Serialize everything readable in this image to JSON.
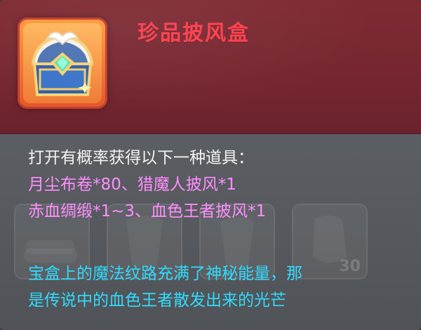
{
  "item": {
    "name": "珍品披风盒",
    "name_color": "#ff3c4a",
    "icon": "treasure-chest-icon"
  },
  "description": {
    "intro": "打开有概率获得以下一种道具：",
    "rewards": [
      "月尘布卷*80、猎魔人披风*1",
      "赤血绸缎*1~3、血色王者披风*1"
    ],
    "flavor": [
      "宝盒上的魔法纹路充满了神秘能量，那",
      "是传说中的血色王者散发出来的光芒"
    ]
  },
  "background_slots": [
    {
      "icon": "cloth-roll-icon"
    },
    {
      "icon": "cape-icon"
    },
    {
      "icon": "cape-icon"
    },
    {
      "icon": "silk-icon",
      "count": "30"
    }
  ],
  "colors": {
    "header": "#7f2a33",
    "body": "#55585c",
    "reward_text": "#ff8dff",
    "flavor_text": "#31dbff",
    "icon_frame": "#ff9a3a"
  }
}
